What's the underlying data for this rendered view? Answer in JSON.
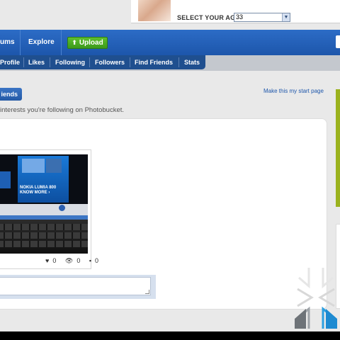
{
  "ad": {
    "age_label": "SELECT YOUR AGE:",
    "age_value": "33"
  },
  "nav": {
    "albums": "ums",
    "explore": "Explore",
    "upload": "Upload"
  },
  "subnav": {
    "items": [
      "Profile",
      "Likes",
      "Following",
      "Followers",
      "Find Friends",
      "Stats"
    ]
  },
  "content": {
    "friends_button": "iends",
    "start_link": "Make this my start page",
    "intro": "interests you're following on Photobucket."
  },
  "photo": {
    "screen_text_1": "NOKIA LUMIA 800",
    "screen_text_2": "KNOW MORE ›",
    "likes": "0",
    "views": "0",
    "comments": "0"
  },
  "colors": {
    "nav_blue": "#1d56ab",
    "subnav_blue": "#1f4f8f",
    "upload_green": "#4aa823",
    "sidebar_green": "#9bb21e"
  },
  "icons": {
    "upload": "up-arrow-icon",
    "likes": "heart-icon",
    "views": "eye-icon",
    "comments": "speech-bubble-icon",
    "dropdown": "chevron-down-icon"
  }
}
